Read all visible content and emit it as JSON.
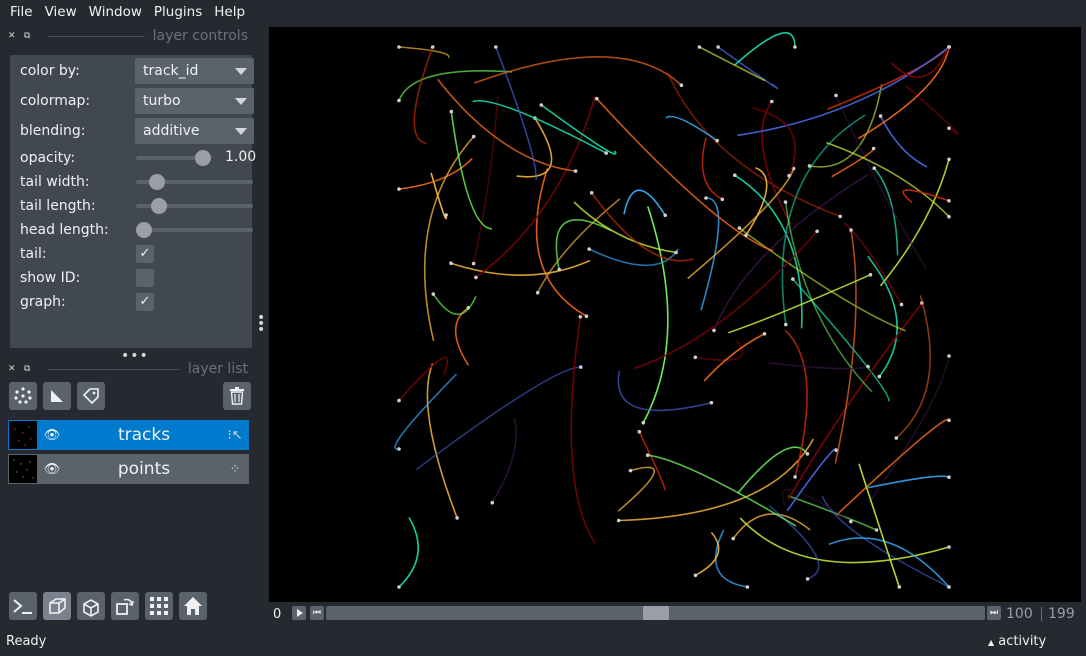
{
  "menu": [
    "File",
    "View",
    "Window",
    "Plugins",
    "Help"
  ],
  "layer_controls": {
    "title": "layer controls",
    "color_by_label": "color by:",
    "color_by_value": "track_id",
    "colormap_label": "colormap:",
    "colormap_value": "turbo",
    "blending_label": "blending:",
    "blending_value": "additive",
    "opacity_label": "opacity:",
    "opacity_value": "1.00",
    "tail_width_label": "tail width:",
    "tail_length_label": "tail length:",
    "head_length_label": "head length:",
    "tail_label": "tail:",
    "show_id_label": "show ID:",
    "graph_label": "graph:",
    "checkmark": "✓",
    "opacity_level": 1.0,
    "tail_width_level": 0.13,
    "tail_length_level": 0.15,
    "head_length_level": 0.0,
    "tail_checked": true,
    "show_id_checked": false,
    "graph_checked": true
  },
  "layer_list": {
    "title": "layer list",
    "layers": [
      {
        "name": "tracks",
        "selected": true
      },
      {
        "name": "points",
        "selected": false
      }
    ]
  },
  "dims": {
    "axis_label": "0",
    "current_frame": "100",
    "total_frames": "199",
    "slider_fraction": 0.5
  },
  "status": {
    "text": "Ready",
    "activity": "activity"
  },
  "colors": {
    "background": "#262930",
    "panel": "#414851",
    "control": "#5a626c",
    "selection": "#007acc",
    "canvas": "#000000"
  }
}
